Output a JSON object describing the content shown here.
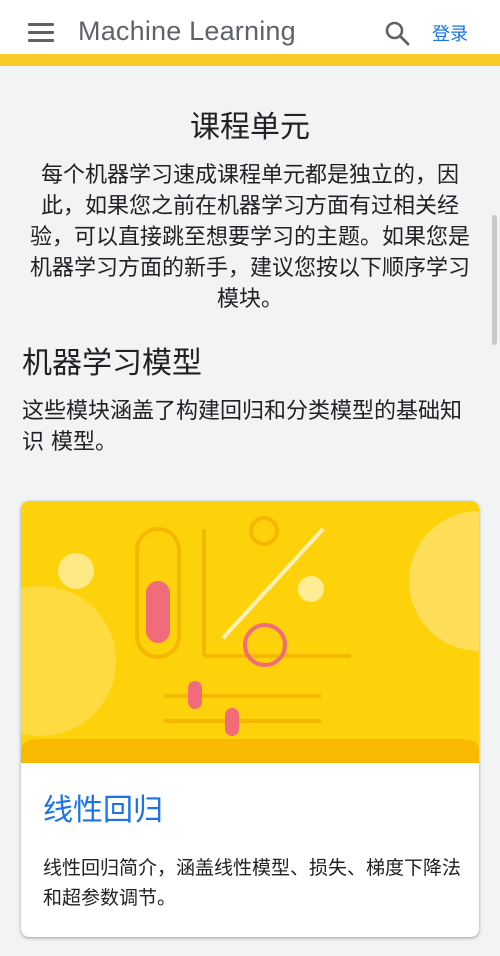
{
  "appbar": {
    "title": "Machine Learning",
    "login_label": "登录",
    "icons": [
      "menu-icon",
      "search-icon"
    ],
    "accent_color": "#f9c929"
  },
  "content": {
    "section_title": "课程单元",
    "intro": "每个机器学习速成课程单元都是独立的，因此，如果您之前在机器学习方面有过相关经验，可以直接跳至想要学习的主题。如果您是机器学习方面的新手，建议您按以下顺序学习模块。",
    "group_title": "机器学习模型",
    "group_desc": "这些模块涵盖了构建回归和分类模型的基础知识 模型。"
  },
  "cards": [
    {
      "title": "线性回归",
      "description": "线性回归简介，涵盖线性模型、损失、梯度下降法和超参数调节。",
      "hero_color": "#fdd20a",
      "title_color": "#1a73e8"
    }
  ]
}
